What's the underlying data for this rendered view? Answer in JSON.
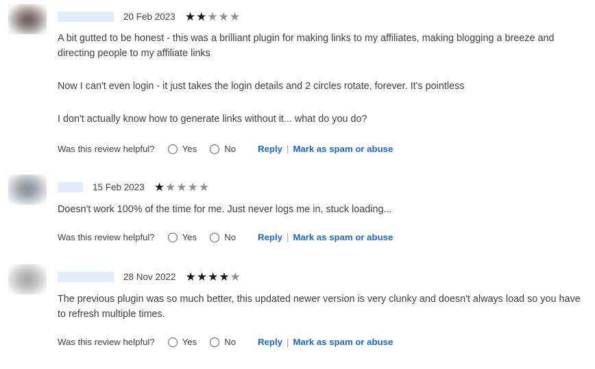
{
  "page": {
    "background": "#ffffff",
    "link_color": "#1967d2",
    "star_on_color": "#1a1a1a",
    "star_off_color": "#8d9197",
    "redaction_color": "#e3ecfa"
  },
  "helpful": {
    "question": "Was this review helpful?",
    "yes_label": "Yes",
    "no_label": "No",
    "reply_label": "Reply",
    "separator": "|",
    "spam_label": "Mark as spam or abuse"
  },
  "star_glyph": "★",
  "reviews": [
    {
      "author_redacted": true,
      "date": "20 Feb 2023",
      "rating": 2,
      "max_rating": 5,
      "avatar": "blurred-avatar-brown",
      "paragraphs": [
        "A bit gutted to be honest - this was a brilliant plugin for making links to my affiliates, making blogging a breeze and directing people to my affiliate links",
        "Now I can't even login - it just takes the login details and 2 circles rotate, forever. It's pointless",
        "I don't actually know how to generate links without it... what do you do?"
      ]
    },
    {
      "author_redacted": true,
      "date": "15 Feb 2023",
      "rating": 1,
      "max_rating": 5,
      "avatar": "blurred-avatar-blue-grey",
      "paragraphs": [
        "Doesn't work 100% of the time for me. Just never logs me in, stuck loading..."
      ]
    },
    {
      "author_redacted": true,
      "date": "28 Nov 2022",
      "rating": 4,
      "max_rating": 5,
      "avatar": "blurred-avatar-grey",
      "paragraphs": [
        "The previous plugin was so much better, this updated newer version is very clunky and doesn't always load so you have to refresh multiple times."
      ]
    }
  ]
}
